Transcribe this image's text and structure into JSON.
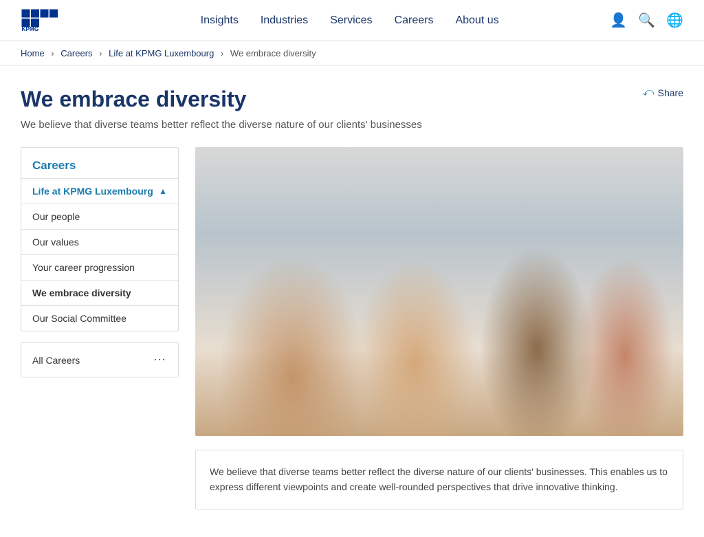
{
  "header": {
    "logo_alt": "KPMG Logo",
    "nav_items": [
      {
        "label": "Insights",
        "id": "insights"
      },
      {
        "label": "Industries",
        "id": "industries"
      },
      {
        "label": "Services",
        "id": "services"
      },
      {
        "label": "Careers",
        "id": "careers"
      },
      {
        "label": "About us",
        "id": "about-us"
      }
    ],
    "icons": [
      {
        "name": "user-icon",
        "symbol": "👤"
      },
      {
        "name": "search-icon",
        "symbol": "🔍"
      },
      {
        "name": "globe-icon",
        "symbol": "🌐"
      }
    ]
  },
  "breadcrumb": {
    "items": [
      {
        "label": "Home",
        "href": "#"
      },
      {
        "label": "Careers",
        "href": "#"
      },
      {
        "label": "Life at KPMG Luxembourg",
        "href": "#"
      }
    ],
    "current": "We embrace diversity"
  },
  "page": {
    "title": "We embrace diversity",
    "subtitle": "We believe that diverse teams better reflect the diverse nature of our clients' businesses",
    "share_label": "Share"
  },
  "sidebar": {
    "title": "Careers",
    "menu_items": [
      {
        "label": "Life at KPMG Luxembourg",
        "id": "life-at-kpmg",
        "active": false,
        "parent": true,
        "has_chevron": true
      },
      {
        "label": "Our people",
        "id": "our-people",
        "active": false
      },
      {
        "label": "Our values",
        "id": "our-values",
        "active": false
      },
      {
        "label": "Your career progression",
        "id": "career-progression",
        "active": false
      },
      {
        "label": "We embrace diversity",
        "id": "embrace-diversity",
        "active": true
      },
      {
        "label": "Our Social Committee",
        "id": "social-committee",
        "active": false
      }
    ],
    "all_careers": {
      "label": "All Careers",
      "id": "all-careers"
    }
  },
  "article": {
    "image_alt": "Diverse team of professionals discussing work together",
    "body_text": "We believe that diverse teams better reflect the diverse nature of our clients' businesses. This enables us to express different viewpoints and create well-rounded perspectives that drive innovative thinking."
  }
}
